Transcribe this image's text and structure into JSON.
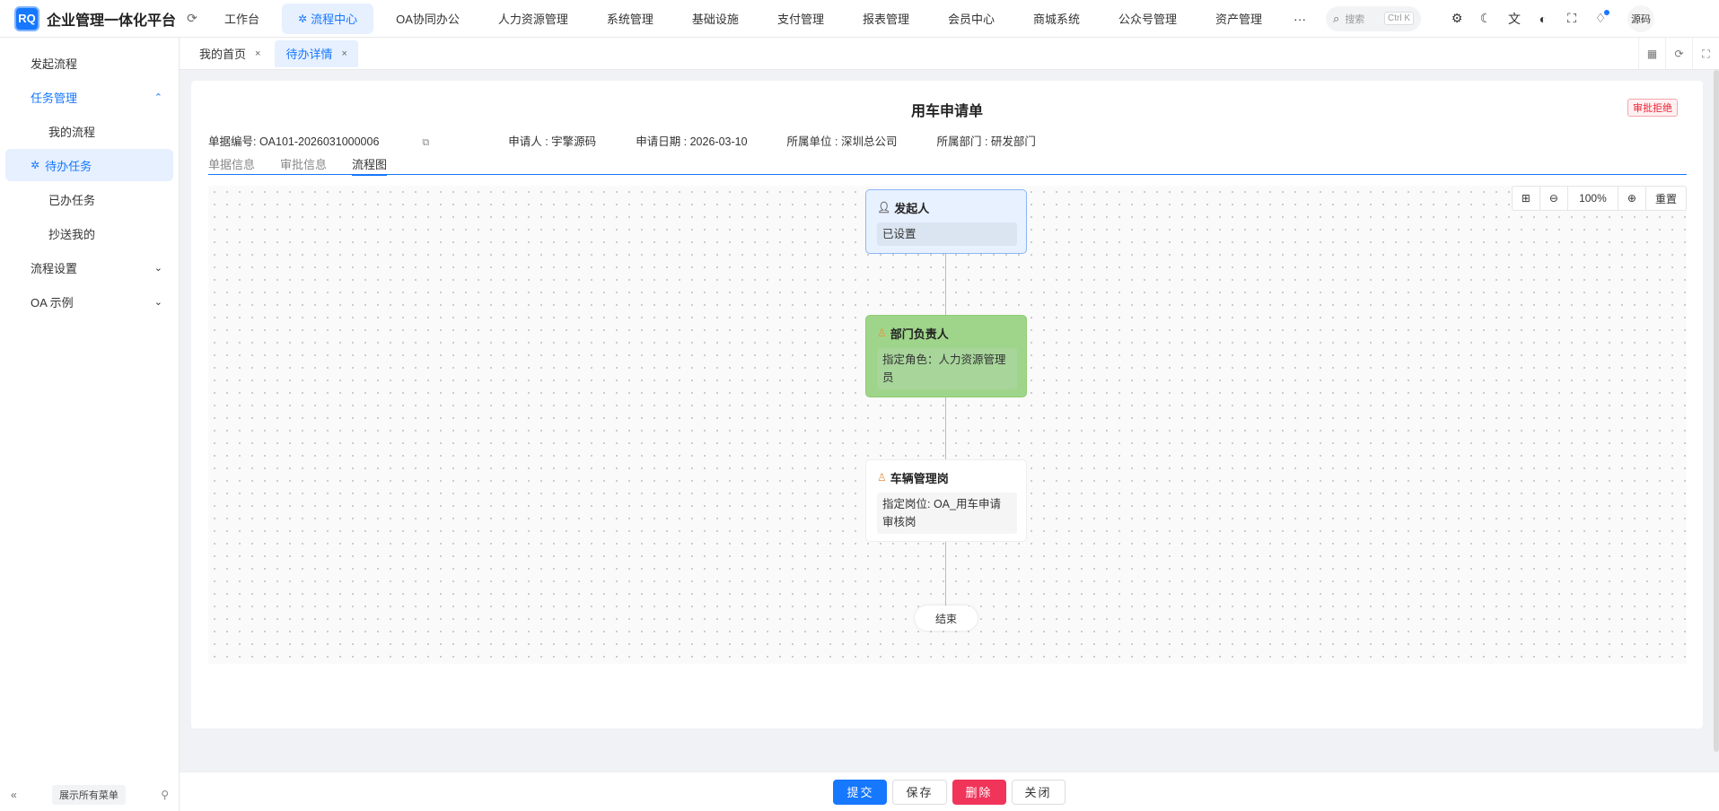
{
  "brand": {
    "logo": "RQ",
    "title": "企业管理一体化平台"
  },
  "nav": {
    "items": [
      {
        "label": "工作台",
        "active": false
      },
      {
        "label": "流程中心",
        "active": true
      },
      {
        "label": "OA协同办公",
        "active": false
      },
      {
        "label": "人力资源管理",
        "active": false
      },
      {
        "label": "系统管理",
        "active": false
      },
      {
        "label": "基础设施",
        "active": false
      },
      {
        "label": "支付管理",
        "active": false
      },
      {
        "label": "报表管理",
        "active": false
      },
      {
        "label": "会员中心",
        "active": false
      },
      {
        "label": "商城系统",
        "active": false
      },
      {
        "label": "公众号管理",
        "active": false
      },
      {
        "label": "资产管理",
        "active": false
      }
    ],
    "more": "···"
  },
  "search": {
    "placeholder": "搜索",
    "shortcut": "Ctrl K"
  },
  "user": {
    "name": "源码"
  },
  "sidebar": {
    "items": [
      {
        "label": "发起流程"
      },
      {
        "label": "任务管理"
      },
      {
        "label": "我的流程"
      },
      {
        "label": "待办任务"
      },
      {
        "label": "已办任务"
      },
      {
        "label": "抄送我的"
      },
      {
        "label": "流程设置"
      },
      {
        "label": "OA 示例"
      }
    ],
    "expand_all": "展示所有菜单"
  },
  "tabs": [
    {
      "label": "我的首页",
      "close": "×"
    },
    {
      "label": "待办详情",
      "close": "×"
    }
  ],
  "form": {
    "title": "用车申请单",
    "status": "审批拒绝",
    "meta": {
      "code": "单据编号: OA101-2026031000006",
      "applicant": "申请人 : 宇擎源码",
      "date": "申请日期 : 2026-03-10",
      "unit": "所属单位 : 深圳总公司",
      "dept": "所属部门 : 研发部门"
    },
    "subtabs": [
      "单据信息",
      "审批信息",
      "流程图"
    ]
  },
  "flow": {
    "zoom": {
      "fit": "⊞",
      "zoom_out": "⊖",
      "level": "100%",
      "zoom_in": "⊕",
      "reset": "重置"
    },
    "nodes": [
      {
        "title": "发起人",
        "body": "已设置",
        "icon": "user-icon"
      },
      {
        "title": "部门负责人",
        "body": "指定角色：人力资源管理员",
        "icon": "approver-icon"
      },
      {
        "title": "车辆管理岗",
        "body": "指定岗位: OA_用车申请审核岗",
        "icon": "approver-icon"
      }
    ],
    "end": "结束"
  },
  "actions": {
    "submit": "提交",
    "save": "保存",
    "delete": "删除",
    "close": "关闭"
  },
  "colors": {
    "primary": "#1677ff",
    "danger": "#f0345a",
    "approved_node": "#9fd58a",
    "start_node": "#e8f1ff"
  }
}
